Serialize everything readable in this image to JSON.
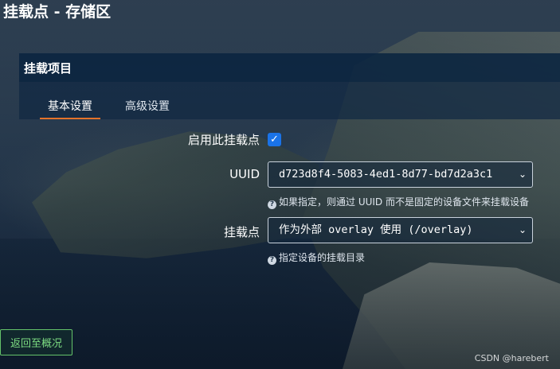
{
  "page": {
    "title": "挂载点 - 存储区"
  },
  "panel": {
    "title": "挂载项目",
    "tabs": [
      {
        "label": "基本设置",
        "active": true
      },
      {
        "label": "高级设置",
        "active": false
      }
    ]
  },
  "form": {
    "enable": {
      "label": "启用此挂载点",
      "checked": true
    },
    "uuid": {
      "label": "UUID",
      "value": "d723d8f4-5083-4ed1-8d77-bd7d2a3c1",
      "hint": "如果指定，则通过 UUID 而不是固定的设备文件来挂载设备"
    },
    "mountpoint": {
      "label": "挂载点",
      "value": "作为外部 overlay 使用 (/overlay)",
      "hint": "指定设备的挂载目录"
    }
  },
  "footer": {
    "back_label": "返回至概况",
    "watermark": "CSDN @harebert"
  },
  "colors": {
    "accent_tab": "#e4732a",
    "checkbox": "#1a73e8",
    "back_button": "#64c26a",
    "panel_header": "#0a2440"
  },
  "icons": {
    "checkbox": "check-icon",
    "select": "chevron-down-icon",
    "hint": "help-icon"
  }
}
